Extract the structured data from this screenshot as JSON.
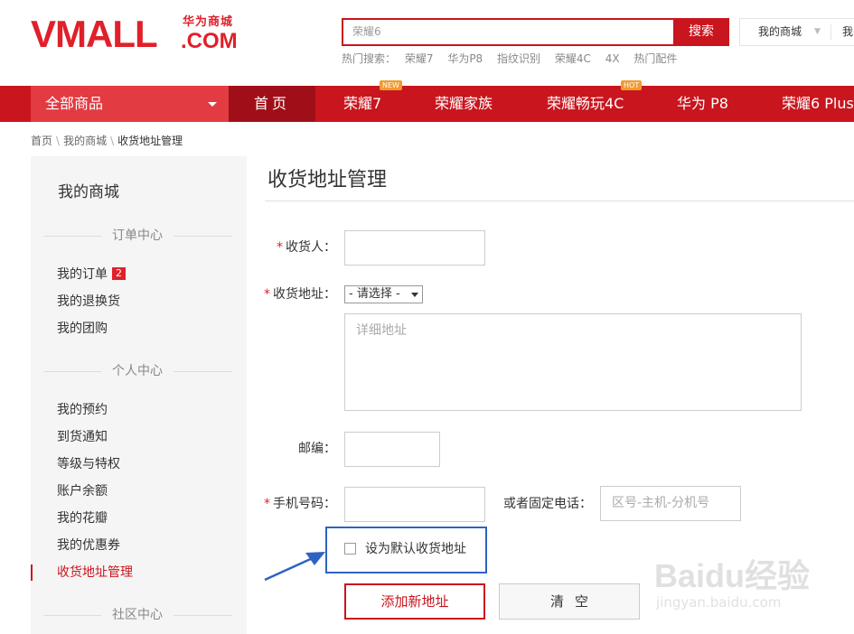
{
  "header": {
    "logo_main": "VMALL",
    "logo_sub": "华为商城",
    "logo_com": ".COM",
    "search_value": "荣耀6",
    "search_button": "搜索",
    "hot_label": "热门搜索：",
    "hot_terms": [
      "荣耀7",
      "华为P8",
      "指纹识别",
      "荣耀4C",
      "4X",
      "热门配件"
    ],
    "my_mall": "我的商城",
    "my_more": "我的"
  },
  "nav": {
    "all_products": "全部商品",
    "home": "首页",
    "items": [
      {
        "label": "荣耀7",
        "tag": "NEW"
      },
      {
        "label": "荣耀家族",
        "tag": ""
      },
      {
        "label": "荣耀畅玩4C",
        "tag": "HOT"
      },
      {
        "label": "华为 P8",
        "tag": ""
      },
      {
        "label": "荣耀6 Plus",
        "tag": ""
      }
    ]
  },
  "breadcrumb": [
    "首页",
    "我的商城",
    "收货地址管理"
  ],
  "sidebar": {
    "title": "我的商城",
    "sections": [
      {
        "label": "订单中心",
        "items": [
          {
            "label": "我的订单",
            "badge": "2"
          },
          {
            "label": "我的退换货",
            "badge": ""
          },
          {
            "label": "我的团购",
            "badge": ""
          }
        ]
      },
      {
        "label": "个人中心",
        "items": [
          {
            "label": "我的预约",
            "badge": ""
          },
          {
            "label": "到货通知",
            "badge": ""
          },
          {
            "label": "等级与特权",
            "badge": ""
          },
          {
            "label": "账户余额",
            "badge": ""
          },
          {
            "label": "我的花瓣",
            "badge": ""
          },
          {
            "label": "我的优惠券",
            "badge": ""
          },
          {
            "label": "收货地址管理",
            "badge": "",
            "active": true
          }
        ]
      },
      {
        "label": "社区中心",
        "items": []
      }
    ]
  },
  "form": {
    "title": "收货地址管理",
    "required_mark": "*",
    "consignee_label": "收货人：",
    "consignee_value": "",
    "address_label": "收货地址：",
    "region_select": "- 请选择 -",
    "address_detail_placeholder": "详细地址",
    "zip_label": "邮编：",
    "zip_value": "",
    "mobile_label": "手机号码：",
    "mobile_value": "",
    "phone_label": "或者固定电话：",
    "phone_placeholder": "区号-主机-分机号",
    "default_checkbox_label": "设为默认收货地址",
    "default_checked": false,
    "add_button": "添加新地址",
    "clear_button": "清空"
  },
  "watermark": {
    "big": "Baidu经验",
    "small": "jingyan.baidu.com"
  },
  "colors": {
    "brand_red": "#c9151e",
    "annotation_blue": "#2e63c4"
  }
}
